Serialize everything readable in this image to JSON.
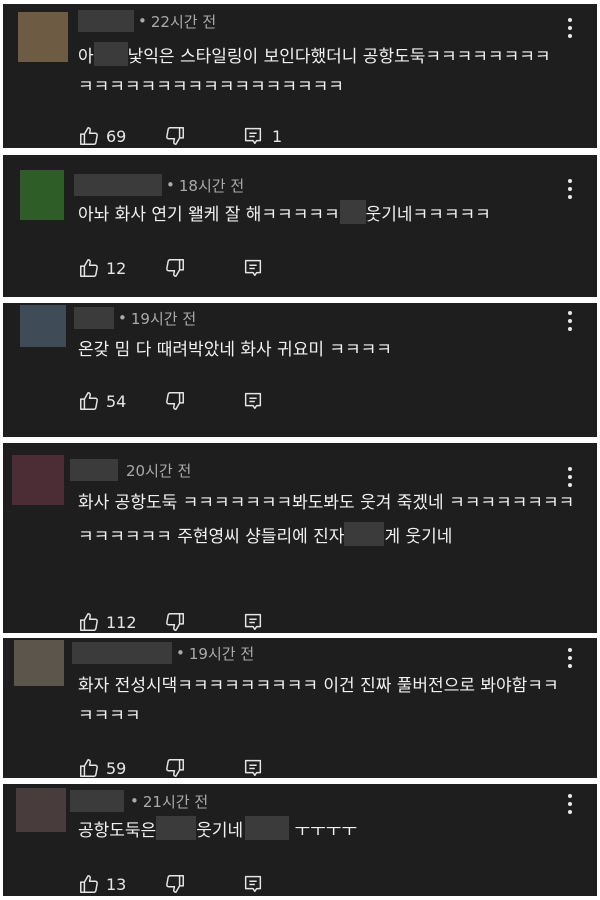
{
  "comments": [
    {
      "time": "22시간 전",
      "separator": "•",
      "avatar_color": "#6e5b43",
      "text": [
        "아",
        "낯익은 스타일링이 보인다했더니 공항도둑ㅋㅋㅋㅋㅋㅋㅋㅋㅋㅋㅋㅋㅋㅋㅋㅋㅋㅋㅋㅋㅋㅋㅋㅋㅋ"
      ],
      "likes": "69",
      "replies": "1",
      "more_icon": "vertical-ellipsis",
      "like_icon": "thumbs-up",
      "dislike_icon": "thumbs-down",
      "reply_icon": "reply-comment"
    },
    {
      "time": "18시간 전",
      "separator": "•",
      "avatar_color": "#2e5d27",
      "text": [
        "아놔 화사 연기 왤케 잘 해ㅋㅋㅋㅋㅋ",
        "웃기네ㅋㅋㅋㅋㅋ"
      ],
      "likes": "12",
      "replies": ""
    },
    {
      "time": "19시간 전",
      "separator": "•",
      "avatar_color": "#3f4b56",
      "text": [
        "온갖 밈 다 때려박았네 화사 귀요미 ㅋㅋㅋㅋ"
      ],
      "likes": "54",
      "replies": ""
    },
    {
      "time": "20시간 전",
      "separator": "",
      "avatar_color": "#4c2d36",
      "text": [
        "화사 공항도둑 ㅋㅋㅋㅋㅋㅋㅋ봐도봐도 웃겨 죽겠네 ㅋㅋㅋㅋㅋㅋㅋㅋㅋㅋㅋㅋㅋㅋ 주현영씨 샹들리에 진자",
        "게 웃기네"
      ],
      "likes": "112",
      "replies": ""
    },
    {
      "time": "19시간 전",
      "separator": "•",
      "avatar_color": "#5c554c",
      "text": [
        "화자 전성시댁ㅋㅋㅋㅋㅋㅋㅋㅋㅋ 이건 진짜 풀버전으로 봐야함ㅋㅋㅋㅋㅋㅋ"
      ],
      "likes": "59",
      "replies": ""
    },
    {
      "time": "21시간 전",
      "separator": "•",
      "avatar_color": "#493c3c",
      "text": [
        "공항도둑은",
        "웃기네",
        "ㅜㅜㅜㅜ"
      ],
      "likes": "13",
      "replies": ""
    }
  ]
}
